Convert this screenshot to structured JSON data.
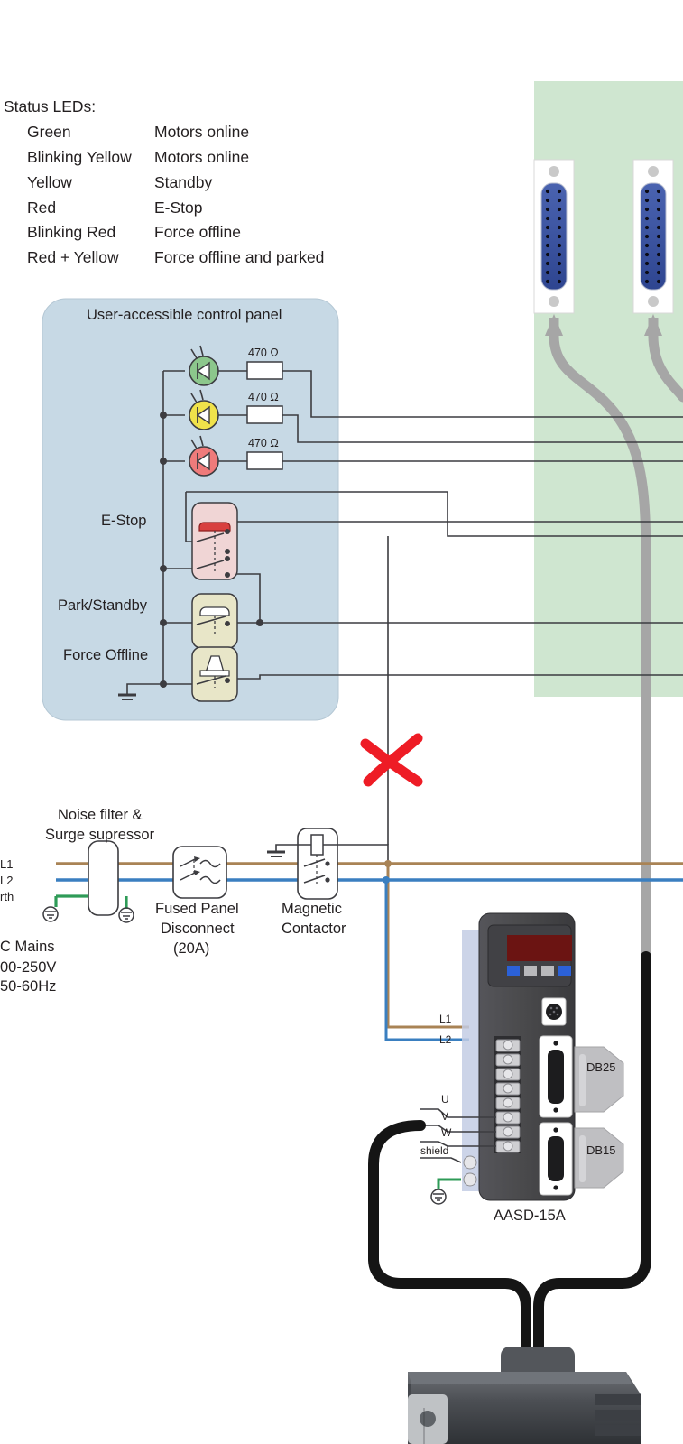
{
  "legend": {
    "title": "Status LEDs:",
    "rows": [
      {
        "state": "Green",
        "meaning": "Motors online"
      },
      {
        "state": "Blinking Yellow",
        "meaning": "Motors online"
      },
      {
        "state": "Yellow",
        "meaning": "Standby"
      },
      {
        "state": "Red",
        "meaning": "E-Stop"
      },
      {
        "state": "Blinking Red",
        "meaning": "Force offline"
      },
      {
        "state": "Red + Yellow",
        "meaning": "Force offline and parked"
      }
    ]
  },
  "control_panel": {
    "title": "User-accessible control panel",
    "fill_color": "#c7d9e5",
    "leds": [
      {
        "name": "green-led",
        "color": "#8cc78c",
        "resistor": "470 Ω"
      },
      {
        "name": "yellow-led",
        "color": "#f0e24a",
        "resistor": "470 Ω"
      },
      {
        "name": "red-led",
        "color": "#ef7b7b",
        "resistor": "470 Ω"
      }
    ],
    "switches": [
      {
        "label": "E-Stop",
        "type": "mushroom-latching",
        "body_color": "#f0d5d5",
        "cap_color": "#d8403f"
      },
      {
        "label": "Park/Standby",
        "type": "momentary-button",
        "body_color": "#e8e6c8",
        "cap_color": "#ffffff"
      },
      {
        "label": "Force Offline",
        "type": "toggle-lever",
        "body_color": "#e8e6c8",
        "cap_color": "#ffffff"
      }
    ]
  },
  "mains": {
    "l1_label": "L1",
    "l2_label": "L2",
    "earth_label": "rth",
    "source_lines": [
      "C Mains",
      "00-250V",
      "50-60Hz"
    ],
    "l1_color": "#a98355",
    "l2_color": "#3a7fc0",
    "earth_color": "#2e9b57"
  },
  "power_blocks": [
    {
      "name": "noise-filter",
      "lines": [
        "Noise filter &",
        "Surge supressor"
      ]
    },
    {
      "name": "fused-panel-disconnect",
      "lines": [
        "Fused Panel",
        "Disconnect",
        "(20A)"
      ]
    },
    {
      "name": "magnetic-contactor",
      "lines": [
        "Magnetic",
        "Contactor"
      ]
    }
  ],
  "drive": {
    "model": "AASD-15A",
    "terminals": [
      "L1",
      "L2",
      "U",
      "V",
      "W",
      "shield"
    ],
    "connectors": [
      {
        "label": "DB25"
      },
      {
        "label": "DB15"
      }
    ],
    "body_color": "#4a4a4c",
    "display_color": "#6b1412"
  },
  "green_panel": {
    "fill_color": "#cfe6d0",
    "connector_count": 2,
    "connector_color": "#3a55a5"
  },
  "annotation": {
    "mark": "red-x-cross-out",
    "color": "#ee1c25"
  }
}
